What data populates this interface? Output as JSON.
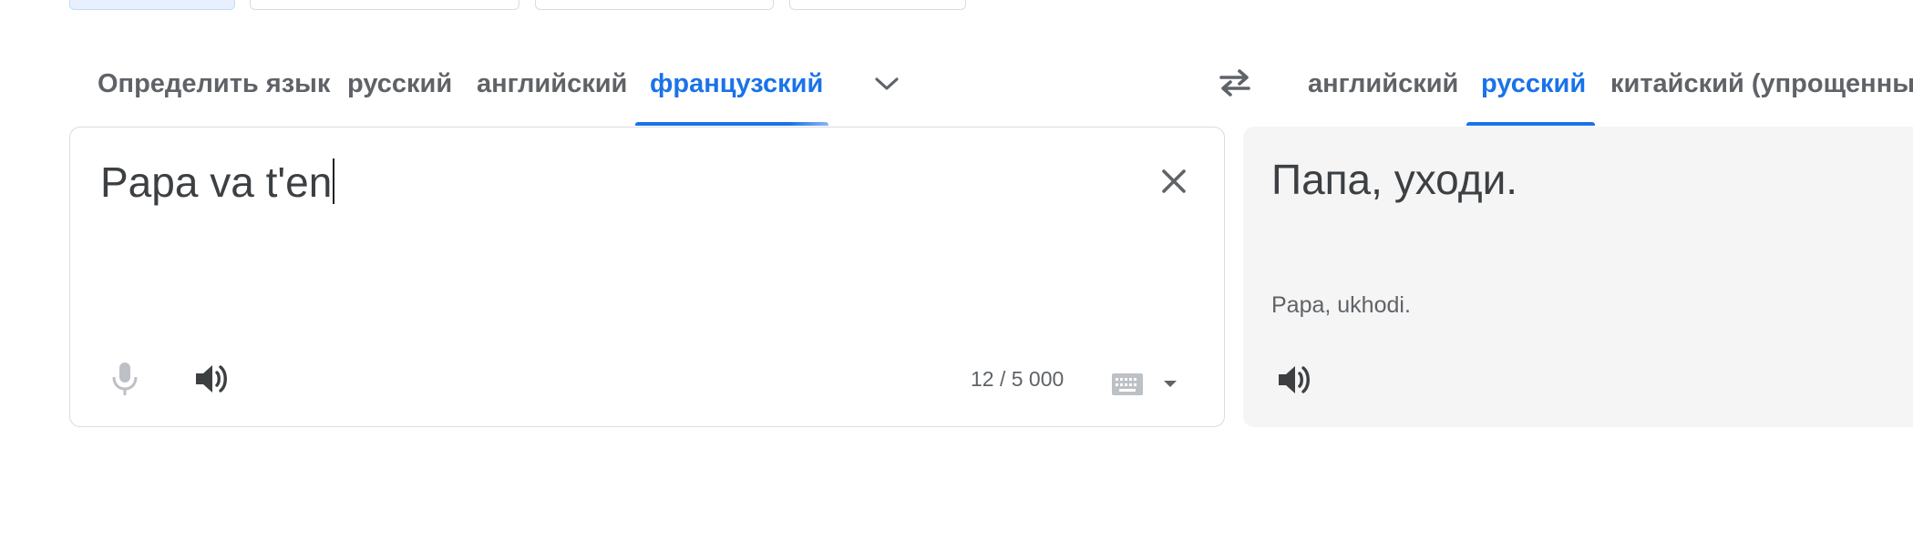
{
  "source_languages": {
    "tabs": [
      {
        "label": "Определить язык",
        "selected": false
      },
      {
        "label": "русский",
        "selected": false
      },
      {
        "label": "английский",
        "selected": false
      },
      {
        "label": "французский",
        "selected": true
      }
    ],
    "more_icon": "chevron-down-icon"
  },
  "swap_icon": "swap-arrows-icon",
  "target_languages": {
    "tabs": [
      {
        "label": "английский",
        "selected": false
      },
      {
        "label": "русский",
        "selected": true
      },
      {
        "label": "китайский (упрощенный",
        "selected": false
      }
    ]
  },
  "source": {
    "text": "Papa va t'en",
    "char_count": "12 / 5 000",
    "clear_icon": "close-icon",
    "mic_icon": "microphone-icon",
    "listen_icon": "speaker-icon",
    "keyboard_icon": "keyboard-icon",
    "keyboard_dropdown_icon": "caret-down-icon"
  },
  "target": {
    "text": "Папа, уходи.",
    "transliteration": "Papa, ukhodi.",
    "listen_icon": "speaker-icon"
  },
  "colors": {
    "accent": "#1a73e8",
    "text": "#3c4043",
    "muted": "#5f6368",
    "target_bg": "#f5f5f5"
  }
}
